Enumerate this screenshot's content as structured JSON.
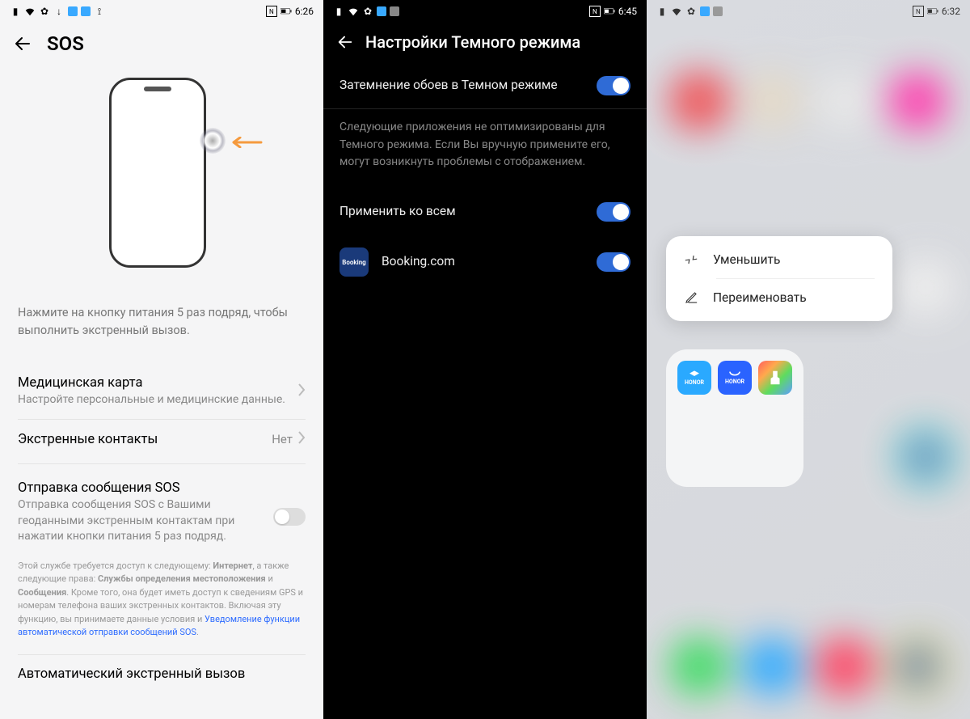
{
  "screenA": {
    "time": "6:26",
    "title": "SOS",
    "instruction": "Нажмите на кнопку питания 5 раз подряд, чтобы выполнить экстренный вызов.",
    "medcard_title": "Медицинская карта",
    "medcard_sub": "Настройте персональные и медицинские данные.",
    "emergency_title": "Экстренные контакты",
    "emergency_value": "Нет",
    "sos_send_title": "Отправка сообщения SOS",
    "sos_send_sub": "Отправка сообщения SOS с Вашими геоданными экстренным контактам при нажатии кнопки питания 5 раз подряд.",
    "sos_send_on": false,
    "fine_1": "Этой службе требуется доступ к следующему: ",
    "fine_b1": "Интернет",
    "fine_2": ", а также следующие права: ",
    "fine_b2": "Службы определения местоположения",
    "fine_3": " и ",
    "fine_b3": "Сообщения",
    "fine_4": ". Кроме того, она будет иметь доступ к сведениям GPS и номерам телефона ваших экстренных контактов. Включая эту функцию, вы принимаете данные условия и ",
    "fine_link": "Уведомление функции автоматической отправки сообщений SOS",
    "fine_5": ".",
    "auto_title": "Автоматический экстренный вызов"
  },
  "screenB": {
    "time": "6:45",
    "title": "Настройки Темного режима",
    "row1_label": "Затемнение обоев в Темном режиме",
    "row1_on": true,
    "description": "Следующие приложения не оптимизированы для Темного режима. Если Вы вручную примените его, могут возникнуть проблемы с отображением.",
    "apply_all_label": "Применить ко всем",
    "apply_all_on": true,
    "app_icon_text": "Booking",
    "app_name": "Booking.com",
    "app_on": true
  },
  "screenC": {
    "time": "6:32",
    "menu_shrink": "Уменьшить",
    "menu_rename": "Переименовать",
    "folder_apps": {
      "a1_label": "HONOR",
      "a2_label": "HONOR"
    }
  }
}
